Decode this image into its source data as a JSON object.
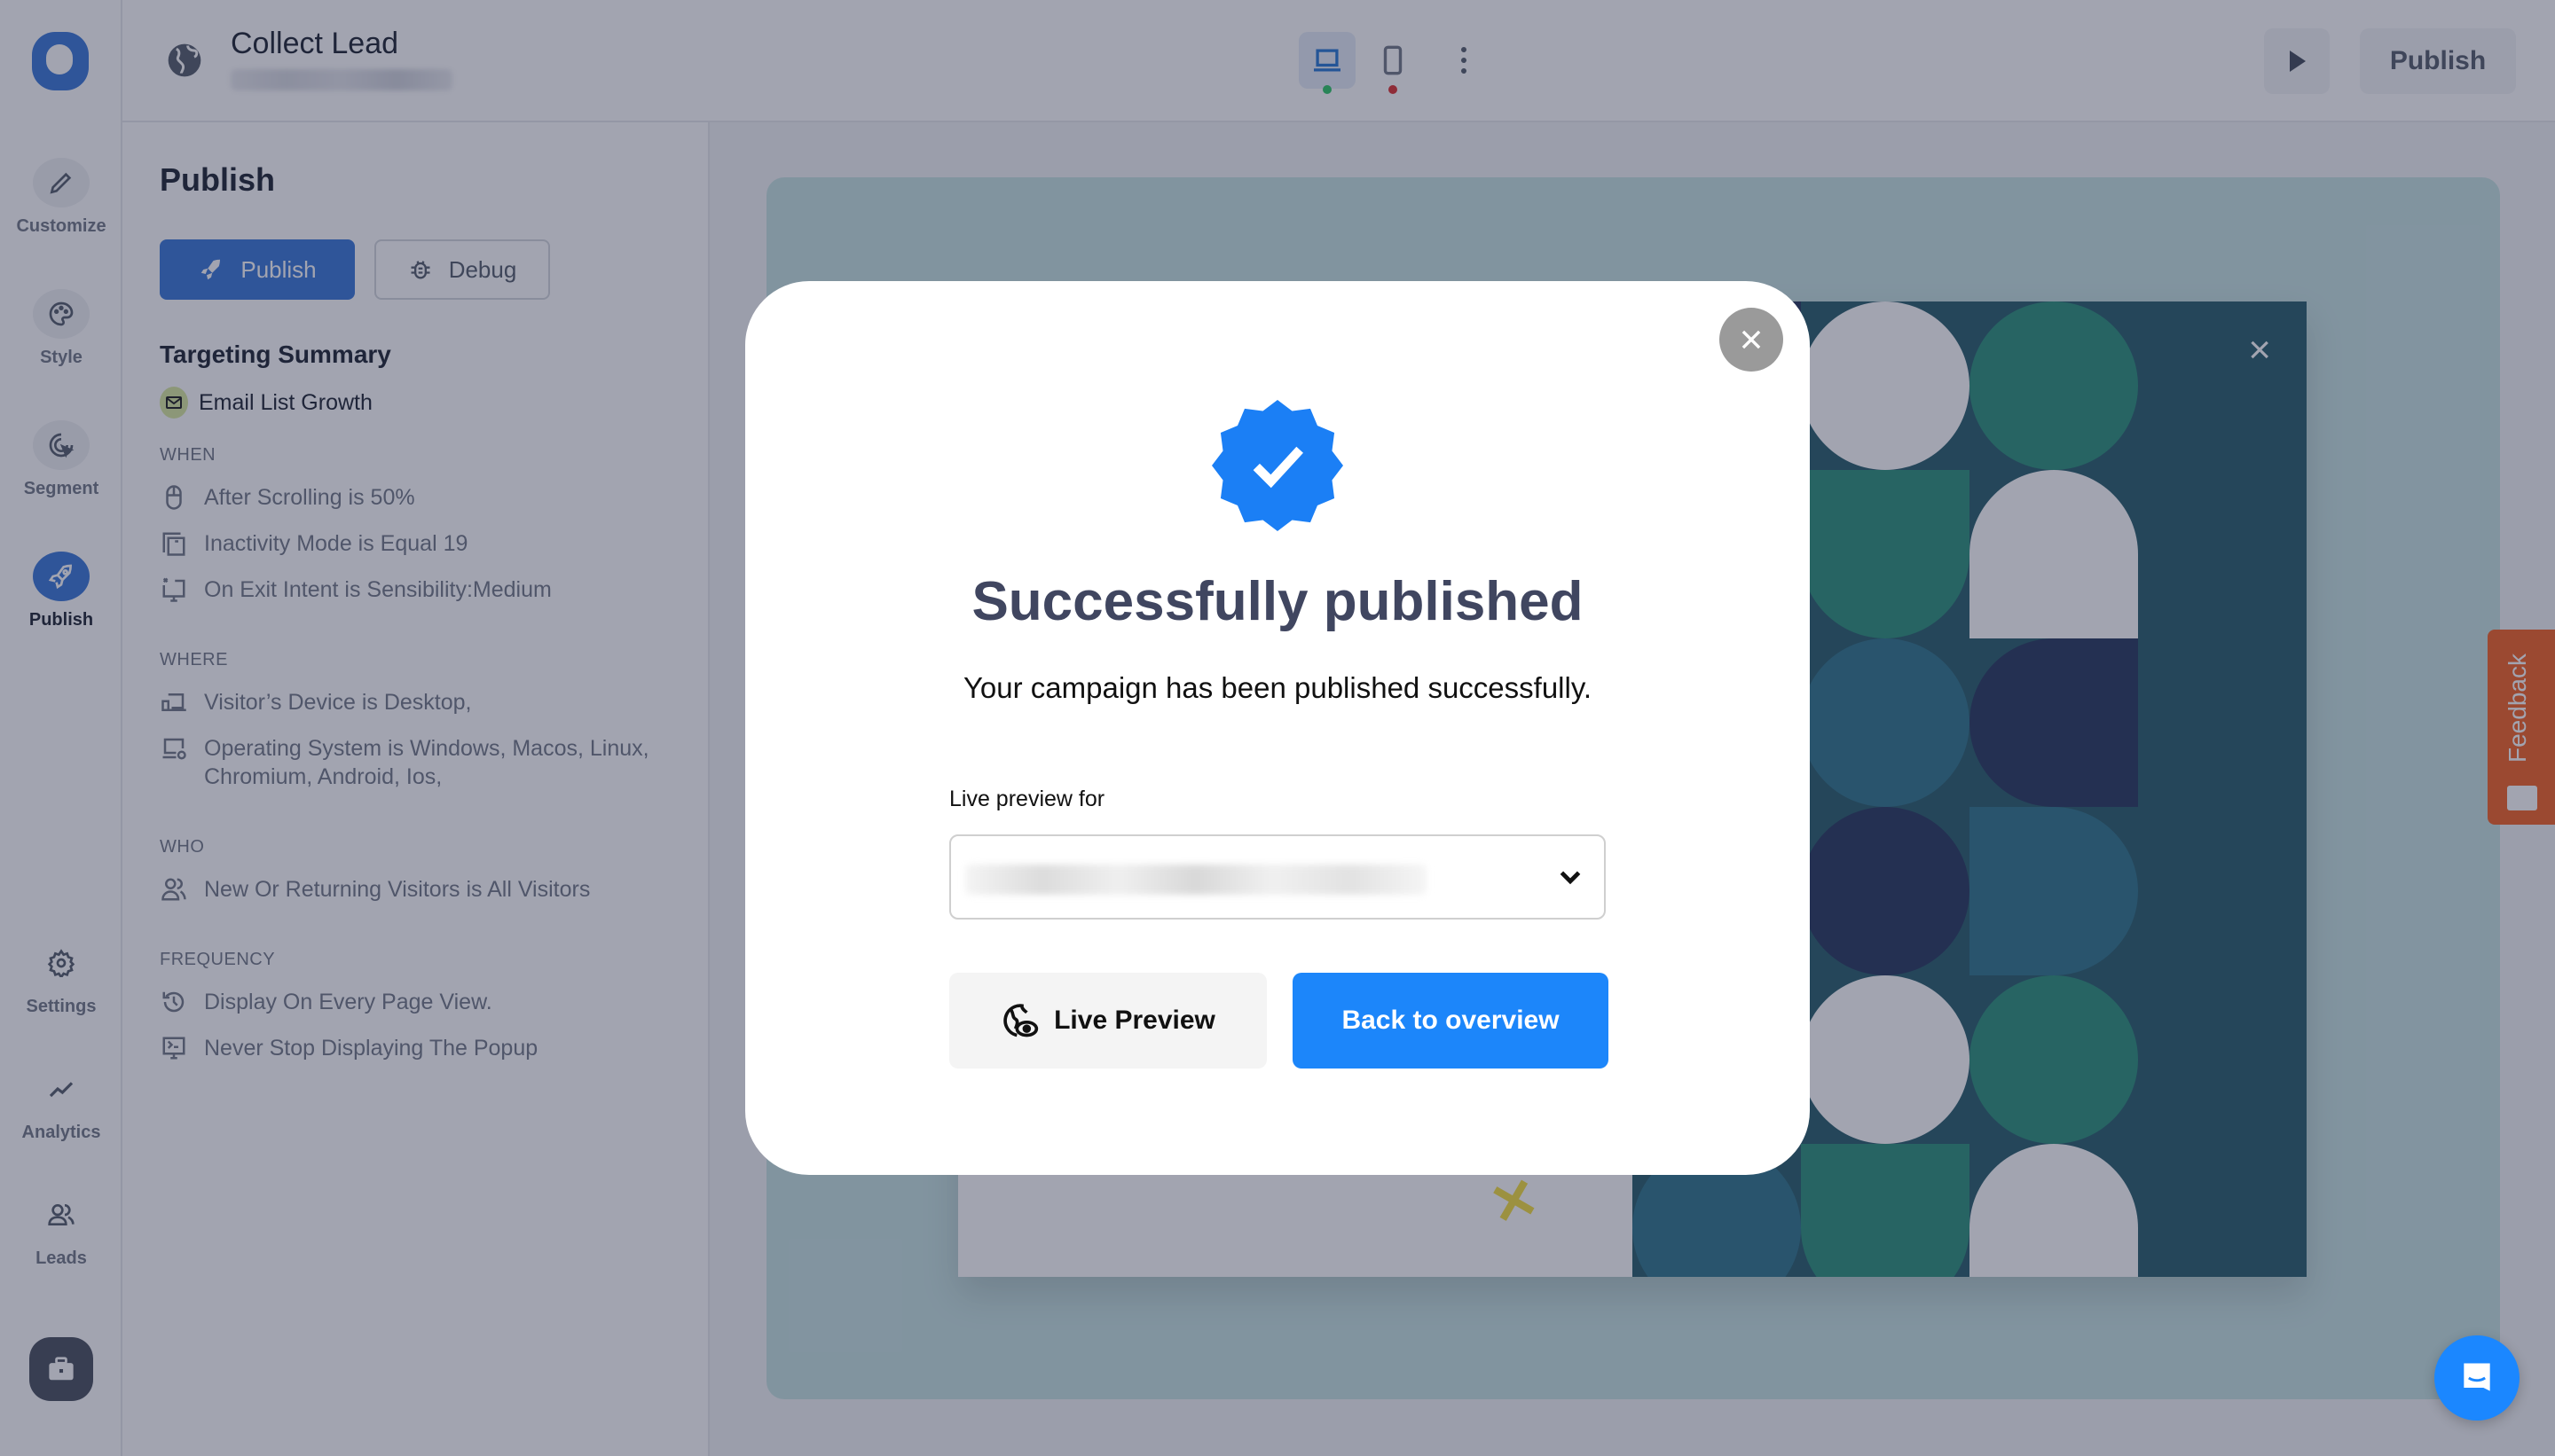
{
  "header": {
    "title": "Collect Lead",
    "subtitle_redacted": true,
    "device_desktop_status_color": "#22c55e",
    "device_mobile_status_color": "#dc2626",
    "preview_label": "Preview",
    "publish_label": "Publish"
  },
  "rail": {
    "items": [
      {
        "label": "Customize",
        "icon": "pencil-icon"
      },
      {
        "label": "Style",
        "icon": "palette-icon"
      },
      {
        "label": "Segment",
        "icon": "target-cursor-icon"
      },
      {
        "label": "Publish",
        "icon": "rocket-icon",
        "active": true
      },
      {
        "label": "Settings",
        "icon": "gear-icon"
      },
      {
        "label": "Analytics",
        "icon": "chart-line-icon"
      },
      {
        "label": "Leads",
        "icon": "users-icon"
      }
    ],
    "toolbox_icon": "briefcase-icon"
  },
  "panel": {
    "title": "Publish",
    "publish_button": "Publish",
    "debug_button": "Debug",
    "summary_title": "Targeting Summary",
    "goal": "Email List Growth",
    "sections": [
      {
        "label": "WHEN",
        "rules": [
          {
            "icon": "mouse-icon",
            "text": "After Scrolling is 50%"
          },
          {
            "icon": "copy-window-icon",
            "text": "Inactivity Mode is Equal 19"
          },
          {
            "icon": "exit-monitor-icon",
            "text": "On Exit Intent is Sensibility:Medium"
          }
        ]
      },
      {
        "label": "WHERE",
        "rules": [
          {
            "icon": "devices-icon",
            "text": "Visitor’s Device is Desktop,"
          },
          {
            "icon": "laptop-gear-icon",
            "text": "Operating System is Windows, Macos, Linux, Chromium, Android, Ios,"
          }
        ]
      },
      {
        "label": "WHO",
        "rules": [
          {
            "icon": "users-icon",
            "text": "New Or Returning Visitors is All Visitors"
          }
        ]
      },
      {
        "label": "FREQUENCY",
        "rules": [
          {
            "icon": "history-icon",
            "text": "Display On Every Page View."
          },
          {
            "icon": "terminal-monitor-icon",
            "text": "Never Stop Displaying The Popup"
          }
        ]
      }
    ]
  },
  "preview": {
    "close_label": "×",
    "accent_yellow": "#f4dc34",
    "pattern_colors": [
      "#1a2d55",
      "#ffffff",
      "#1f8a74",
      "#246e86",
      "#1d5563"
    ]
  },
  "modal": {
    "title": "Successfully published",
    "subtitle": "Your campaign has been published successfully.",
    "field_label": "Live preview for",
    "select_value_redacted": true,
    "live_preview_button": "Live Preview",
    "back_button": "Back to overview",
    "accent_color": "#1c86fa"
  },
  "widgets": {
    "feedback_label": "Feedback",
    "feedback_color": "#f35a18",
    "chat_color": "#1b87ff"
  }
}
